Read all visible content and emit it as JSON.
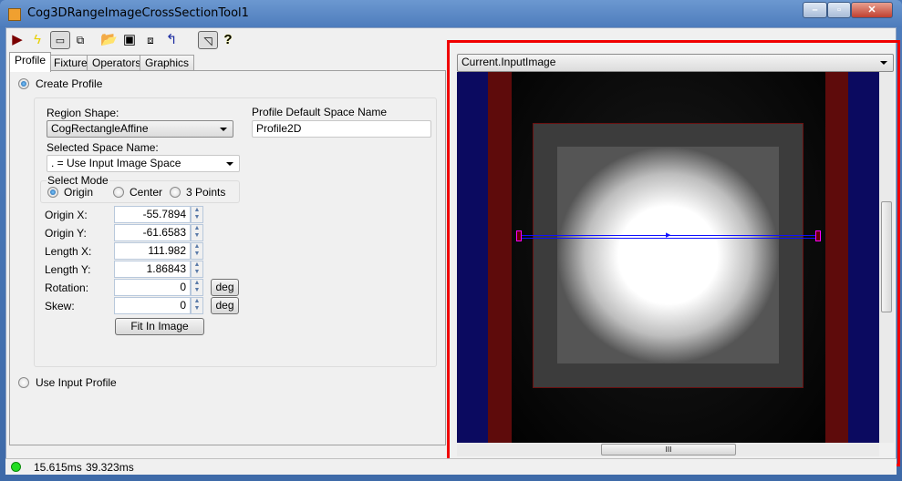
{
  "window": {
    "title": "Cog3DRangeImageCrossSectionTool1",
    "controls": [
      "minimize",
      "maximize",
      "close"
    ]
  },
  "toolbar": {
    "icons": [
      "run-icon",
      "electric-icon",
      "show-controls-icon",
      "float-window-icon",
      "open-icon",
      "save-icon",
      "save-as-icon",
      "reset-icon",
      "graphics-toggle-icon",
      "help-icon"
    ]
  },
  "tabs": [
    {
      "label": "Profile"
    },
    {
      "label": "Fixture"
    },
    {
      "label": "Operators"
    },
    {
      "label": "Graphics"
    }
  ],
  "profile": {
    "create_profile": "Create Profile",
    "region_shape_label": "Region Shape:",
    "region_shape": "CogRectangleAffine",
    "default_space_label": "Profile Default Space Name",
    "default_space": "Profile2D",
    "selected_space_label": "Selected Space Name:",
    "selected_space": ". = Use Input Image Space",
    "select_mode_label": "Select Mode",
    "modes": [
      "Origin",
      "Center",
      "3 Points"
    ],
    "fields": [
      {
        "label": "Origin X:",
        "value": "-55.7894"
      },
      {
        "label": "Origin Y:",
        "value": "-61.6583"
      },
      {
        "label": "Length X:",
        "value": "111.982"
      },
      {
        "label": "Length Y:",
        "value": "1.86843"
      },
      {
        "label": "Rotation:",
        "value": "0",
        "unit": "deg"
      },
      {
        "label": "Skew:",
        "value": "0",
        "unit": "deg"
      }
    ],
    "fit_button": "Fit In Image",
    "use_input_profile": "Use Input Profile"
  },
  "viewer": {
    "image_select": "Current.InputImage",
    "scroll_grip": "III"
  },
  "status": {
    "time1": "15.615ms",
    "time2": "39.323ms",
    "indicator_color": "#22dd22"
  },
  "colors": {
    "highlight": "#f00000",
    "navy": "#0b0a60",
    "dark_red": "#5e0b0b",
    "region_line": "#1010ff"
  }
}
